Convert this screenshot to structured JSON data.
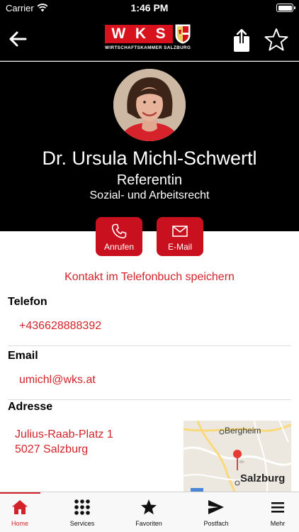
{
  "status_bar": {
    "carrier": "Carrier",
    "time": "1:46 PM"
  },
  "nav": {
    "logo_letters": [
      "W",
      "K",
      "S"
    ],
    "logo_subtitle": "WIRTSCHAFTSKAMMER SALZBURG"
  },
  "profile": {
    "name": "Dr. Ursula Michl-Schwertl",
    "role": "Referentin",
    "department": "Sozial- und Arbeitsrecht"
  },
  "actions": {
    "call_label": "Anrufen",
    "email_label": "E-Mail"
  },
  "save_contact_label": "Kontakt im Telefonbuch speichern",
  "contact": {
    "phone_label": "Telefon",
    "phone": "+436628888392",
    "email_label": "Email",
    "email": "umichl@wks.at",
    "address_label": "Adresse",
    "address_line1": "Julius-Raab-Platz 1",
    "address_line2": "5027 Salzburg"
  },
  "map": {
    "label_top": "Bergheim",
    "label_bottom": "Salzburg"
  },
  "tabs": [
    {
      "label": "Home",
      "icon": "home-icon",
      "active": true
    },
    {
      "label": "Services",
      "icon": "grid-icon",
      "active": false
    },
    {
      "label": "Favoriten",
      "icon": "star-icon",
      "active": false
    },
    {
      "label": "Postfach",
      "icon": "send-icon",
      "active": false
    },
    {
      "label": "Mehr",
      "icon": "menu-icon",
      "active": false
    }
  ],
  "colors": {
    "accent": "#d2232a",
    "header_bg": "#000000",
    "button_bg": "#c8101e"
  }
}
